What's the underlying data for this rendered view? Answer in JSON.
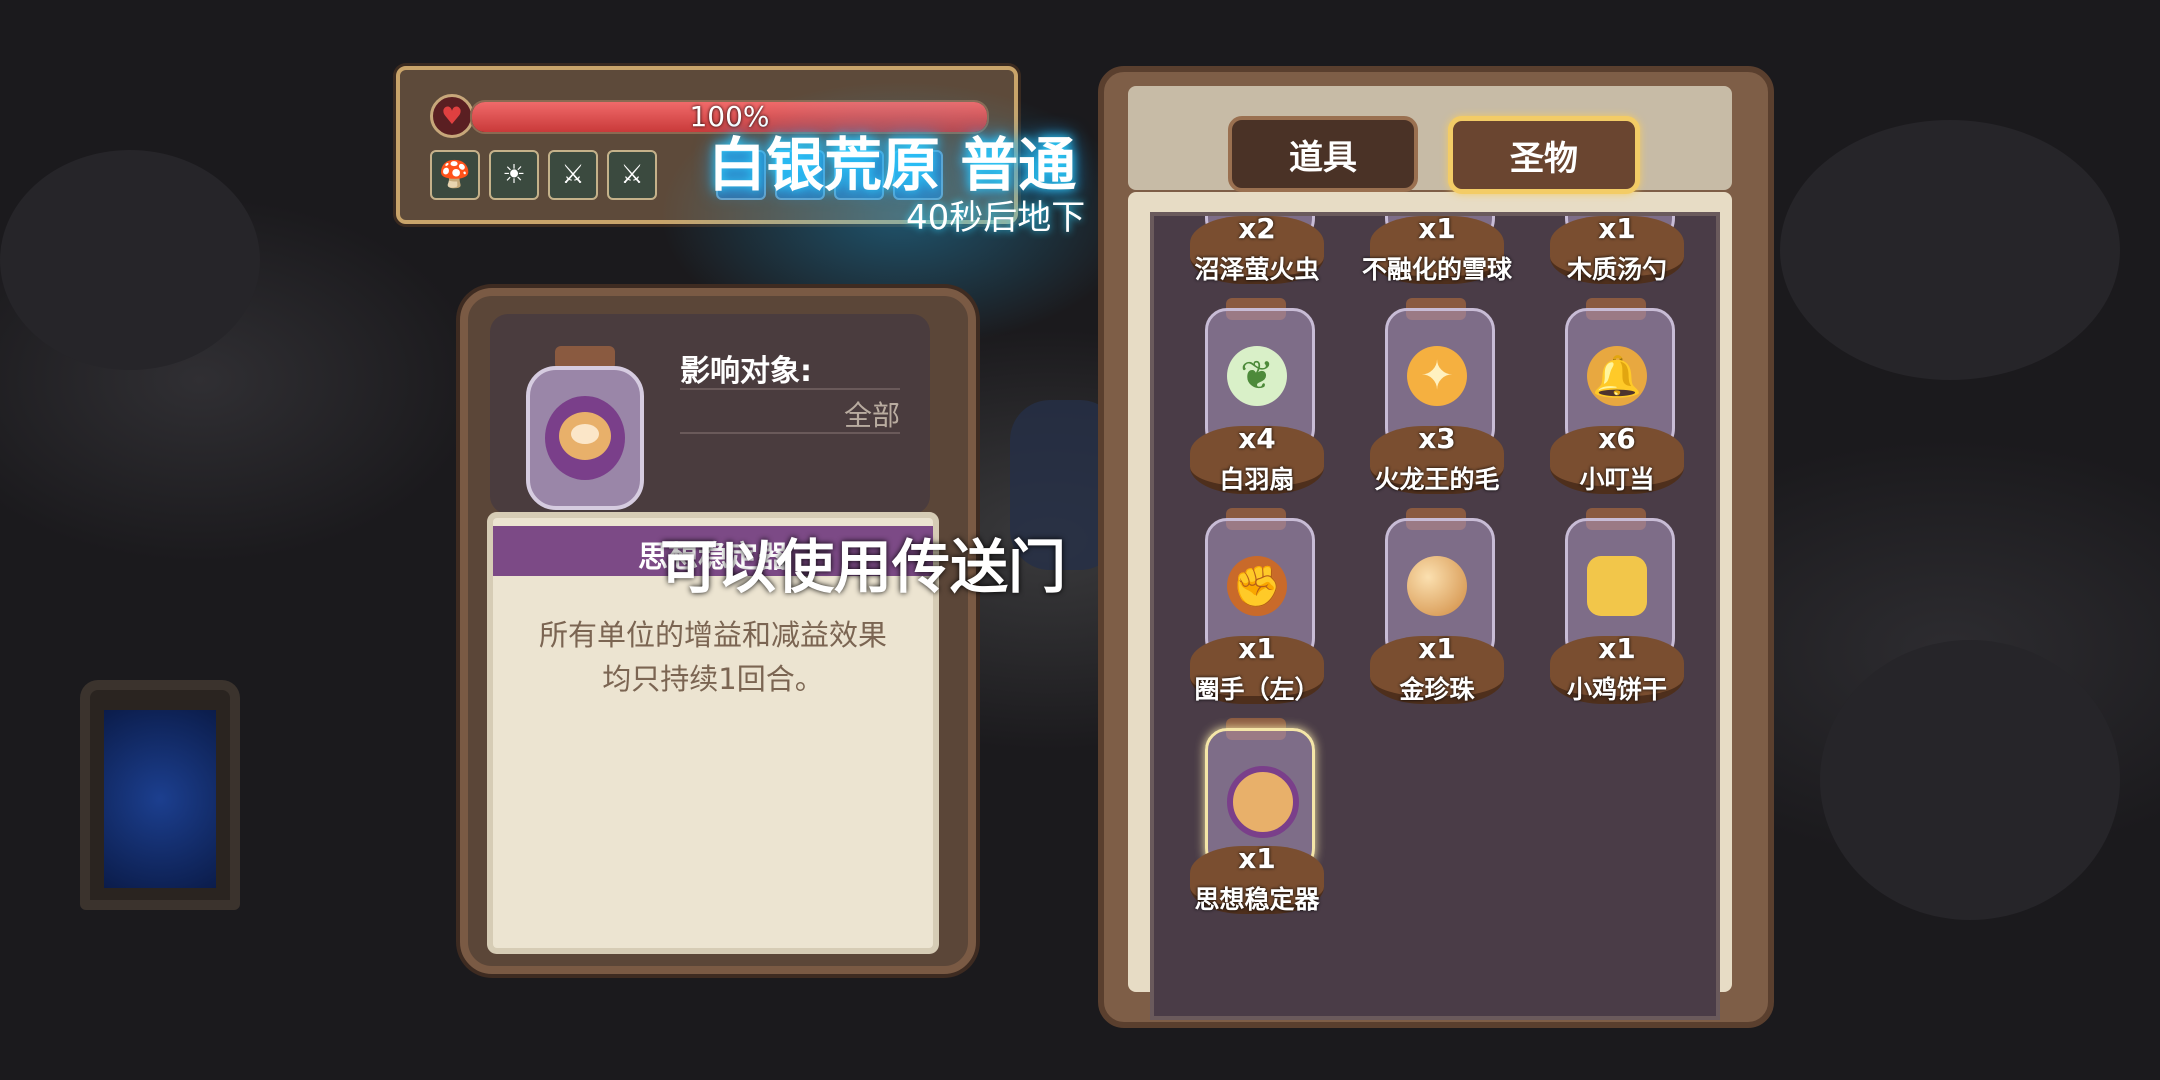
{
  "hp": {
    "percent_label": "100%",
    "fill_percent": 100
  },
  "stage": {
    "title": "白银荒原 普通",
    "countdown": "40秒后地下"
  },
  "detail": {
    "affect_label": "影响对象:",
    "affect_value": "全部",
    "item_name": "思想稳定器",
    "description_line1": "所有单位的增益和减益效果",
    "description_line2": "均只持续1回合。"
  },
  "toast": "可以使用传送门",
  "tabs": {
    "tools": "道具",
    "relics": "圣物"
  },
  "items": [
    {
      "name": "沼泽萤火虫",
      "count": "x2"
    },
    {
      "name": "不融化的雪球",
      "count": "x1"
    },
    {
      "name": "木质汤勺",
      "count": "x1"
    },
    {
      "name": "白羽扇",
      "count": "x4",
      "icon": "feather-fan-icon"
    },
    {
      "name": "火龙王的毛",
      "count": "x3",
      "icon": "flame-fur-icon"
    },
    {
      "name": "小叮当",
      "count": "x6",
      "icon": "bell-icon"
    },
    {
      "name": "圈手（左）",
      "count": "x1",
      "icon": "fist-icon"
    },
    {
      "name": "金珍珠",
      "count": "x1",
      "icon": "pearl-icon"
    },
    {
      "name": "小鸡饼干",
      "count": "x1",
      "icon": "biscuit-icon"
    },
    {
      "name": "思想稳定器",
      "count": "x1",
      "icon": "stabilizer-icon"
    }
  ]
}
